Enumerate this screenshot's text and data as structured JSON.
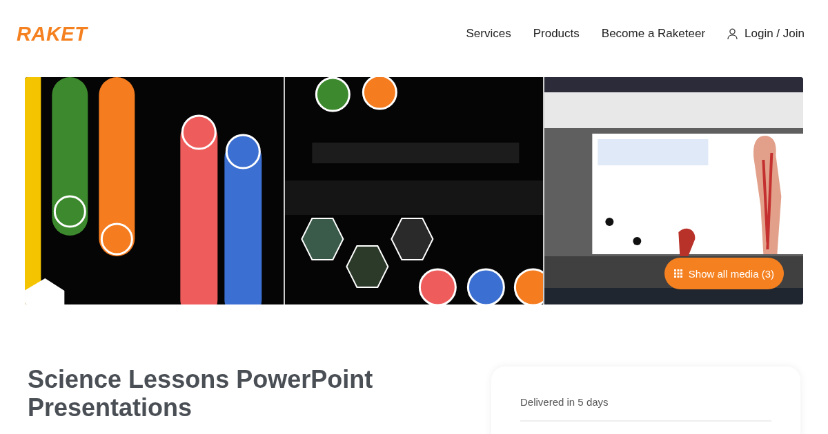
{
  "header": {
    "logo": "RAKET",
    "nav": [
      {
        "label": "Services"
      },
      {
        "label": "Products"
      },
      {
        "label": "Become a Raketeer"
      }
    ],
    "login": "Login / Join"
  },
  "gallery": {
    "show_all": "Show all media (3)"
  },
  "title": "Science Lessons PowerPoint Presentations",
  "card": {
    "delivery": "Delivered in 5 days"
  }
}
